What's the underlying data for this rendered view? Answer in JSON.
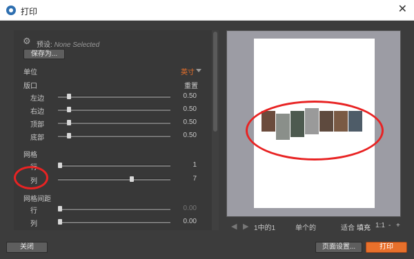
{
  "window": {
    "title": "打印"
  },
  "settings": {
    "preset_label": "预设:",
    "preset_value": "None Selected",
    "save_as": "保存为...",
    "unit_label": "单位",
    "unit_value": "英寸",
    "margins_section": "版口",
    "reset": "重置",
    "margins": [
      {
        "label": "左边",
        "value": "0.50",
        "level": 0.08
      },
      {
        "label": "右边",
        "value": "0.50",
        "level": 0.08
      },
      {
        "label": "顶部",
        "value": "0.50",
        "level": 0.08
      },
      {
        "label": "底部",
        "value": "0.50",
        "level": 0.08
      }
    ],
    "grid_section": "网格",
    "grid": [
      {
        "label": "行",
        "value": "1",
        "level": 0.0
      },
      {
        "label": "列",
        "value": "7",
        "level": 0.66
      }
    ],
    "spacing_section": "网格间距",
    "spacing": [
      {
        "label": "行",
        "value": "0.00",
        "level": 0.0
      },
      {
        "label": "列",
        "value": "0.00",
        "level": 0.0
      }
    ]
  },
  "preview": {
    "page_of": "1中的1",
    "mode": "单个的",
    "fit": "适合",
    "fill": "填充",
    "ratio": "1:1",
    "zoom_out": "-",
    "zoom_in": "+",
    "thumbnails": [
      {
        "name": "thumbnail-1",
        "color": "#6b4b3c"
      },
      {
        "name": "thumbnail-2",
        "color": "#8a8f8a"
      },
      {
        "name": "thumbnail-3",
        "color": "#4d5a4f"
      },
      {
        "name": "thumbnail-4",
        "color": "#9a9a9a"
      },
      {
        "name": "thumbnail-5",
        "color": "#5e4a3e"
      },
      {
        "name": "thumbnail-6",
        "color": "#7a5a44"
      },
      {
        "name": "thumbnail-7",
        "color": "#4e5c68"
      }
    ]
  },
  "footer": {
    "close": "关闭",
    "page_setup": "页面设置...",
    "print": "打印"
  },
  "colors": {
    "accent": "#e8702b",
    "annotation": "#e82323",
    "panel": "#383838"
  }
}
